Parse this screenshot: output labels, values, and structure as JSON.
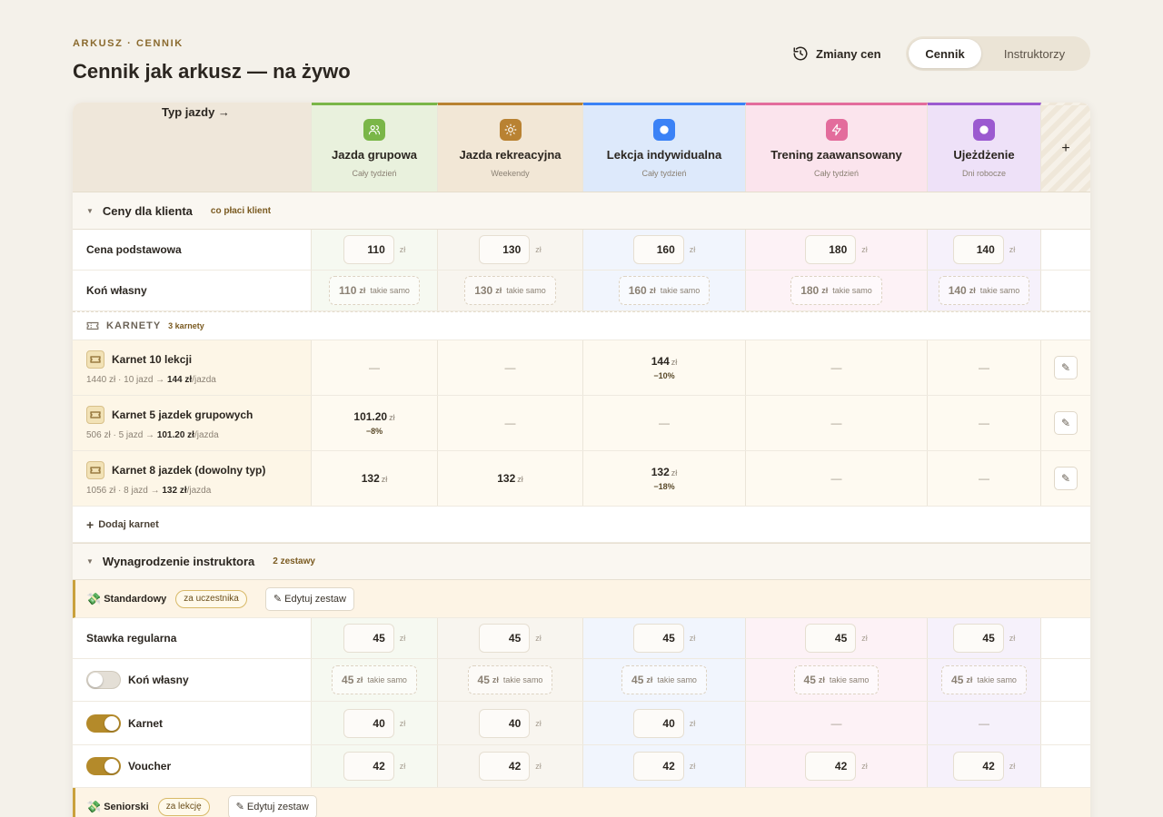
{
  "header": {
    "eyebrow": "ARKUSZ · CENNIK",
    "title": "Cennik jak arkusz — na żywo",
    "history_label": "Zmiany cen",
    "tabs": [
      {
        "label": "Cennik",
        "active": true
      },
      {
        "label": "Instruktorzy",
        "active": false
      }
    ]
  },
  "table": {
    "corner_label": "Typ jazdy →",
    "add_column": "+",
    "columns": [
      {
        "name": "Jazda grupowa",
        "sub": "Cały tydzień",
        "color": "#7ab648",
        "icon": "users-icon"
      },
      {
        "name": "Jazda rekreacyjna",
        "sub": "Weekendy",
        "color": "#b98232",
        "icon": "sun-icon"
      },
      {
        "name": "Lekcja indywidualna",
        "sub": "Cały tydzień",
        "color": "#3b82f6",
        "icon": "circle-icon"
      },
      {
        "name": "Trening zaawansowany",
        "sub": "Cały tydzień",
        "color": "#e36c9c",
        "icon": "bolt-icon"
      },
      {
        "name": "Ujeżdżenie",
        "sub": "Dni robocze",
        "color": "#9b5ad0",
        "icon": "circle-icon"
      }
    ]
  },
  "client": {
    "title": "Ceny dla klienta",
    "note": "co płaci klient",
    "unit": "zł",
    "same": "takie samo",
    "base_label": "Cena podstawowa",
    "base": [
      "110",
      "130",
      "160",
      "180",
      "140"
    ],
    "own_label": "Koń własny",
    "own": [
      "110",
      "130",
      "160",
      "180",
      "140"
    ]
  },
  "karnety": {
    "title": "KARNETY",
    "count": "3 karnety",
    "add_label": "Dodaj karnet",
    "items": [
      {
        "name": "Karnet 10 lekcji",
        "desc_pre": "1440 zł · 10 jazd → ",
        "desc_bold": "144 zł",
        "desc_post": "/jazda",
        "vals": [
          null,
          null,
          {
            "v": "144",
            "d": "−10%"
          },
          null,
          null
        ]
      },
      {
        "name": "Karnet 5 jazdek grupowych",
        "desc_pre": "506 zł · 5 jazd → ",
        "desc_bold": "101.20 zł",
        "desc_post": "/jazda",
        "vals": [
          {
            "v": "101.20",
            "d": "−8%"
          },
          null,
          null,
          null,
          null
        ]
      },
      {
        "name": "Karnet 8 jazdek (dowolny typ)",
        "desc_pre": "1056 zł · 8 jazd → ",
        "desc_bold": "132 zł",
        "desc_post": "/jazda",
        "vals": [
          {
            "v": "132",
            "d": ""
          },
          {
            "v": "132",
            "d": ""
          },
          {
            "v": "132",
            "d": "−18%"
          },
          null,
          null
        ]
      }
    ],
    "empty": "—"
  },
  "instructor": {
    "title": "Wynagrodzenie instruktora",
    "note": "2 zestawy",
    "sets": [
      {
        "name": "Standardowy",
        "pill": "za uczestnika",
        "edit": "✎ Edytuj zestaw"
      },
      {
        "name": "Seniorski",
        "pill": "za lekcję",
        "edit": "✎ Edytuj zestaw"
      }
    ],
    "regular_label": "Stawka regularna",
    "regular": [
      "45",
      "45",
      "45",
      "45",
      "45"
    ],
    "own_label": "Koń własny",
    "own_on": false,
    "own": [
      "45",
      "45",
      "45",
      "45",
      "45"
    ],
    "karnet_label": "Karnet",
    "karnet_on": true,
    "karnet": [
      "40",
      "40",
      "40",
      null,
      null
    ],
    "voucher_label": "Voucher",
    "voucher_on": true,
    "voucher": [
      "42",
      "42",
      "42",
      "42",
      "42"
    ]
  }
}
